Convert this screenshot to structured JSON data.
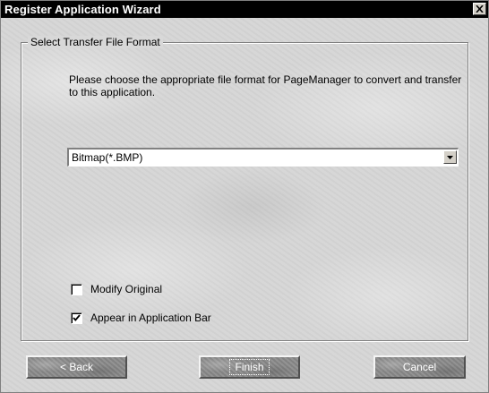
{
  "window": {
    "title": "Register Application Wizard"
  },
  "group": {
    "legend": "Select Transfer File Format"
  },
  "instruction": "Please choose the appropriate file format for PageManager to convert and transfer to this application.",
  "format_select": {
    "value": "Bitmap(*.BMP)"
  },
  "options": {
    "modify_original": {
      "label": "Modify Original",
      "checked": false
    },
    "appear_in_app_bar": {
      "label": "Appear in Application Bar",
      "checked": true
    }
  },
  "buttons": {
    "back": "< Back",
    "finish": "Finish",
    "cancel": "Cancel"
  },
  "icons": {
    "close": "close-icon",
    "dropdown": "chevron-down-icon",
    "check": "checkmark-icon"
  }
}
